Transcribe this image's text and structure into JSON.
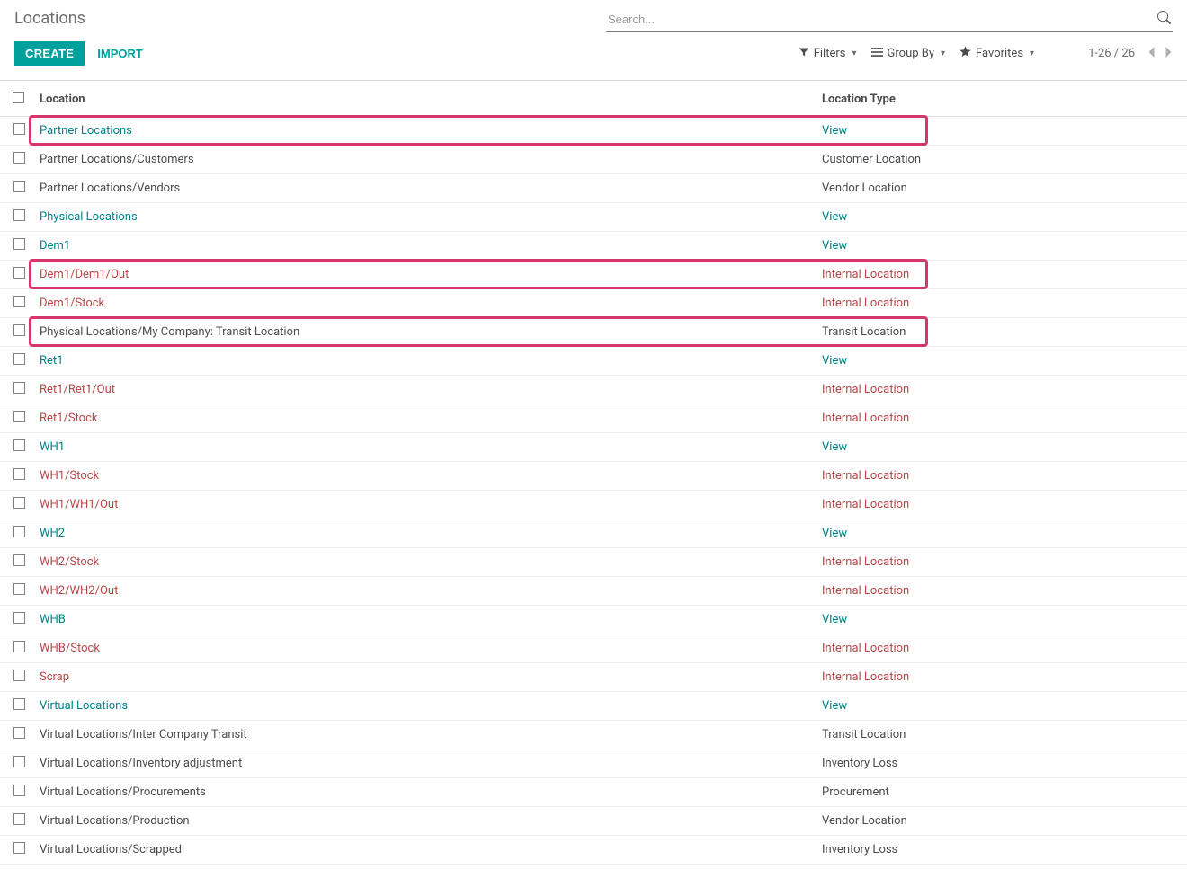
{
  "header": {
    "title": "Locations",
    "search_placeholder": "Search...",
    "create": "CREATE",
    "import": "IMPORT",
    "filters": "Filters",
    "group_by": "Group By",
    "favorites": "Favorites",
    "pager": "1-26 / 26"
  },
  "columns": {
    "location": "Location",
    "type": "Location Type"
  },
  "rows": [
    {
      "loc": "Partner Locations",
      "type": "View",
      "loc_style": "teal",
      "type_style": "teal",
      "hl": true
    },
    {
      "loc": "Partner Locations/Customers",
      "type": "Customer Location",
      "loc_style": "dark",
      "type_style": "dark"
    },
    {
      "loc": "Partner Locations/Vendors",
      "type": "Vendor Location",
      "loc_style": "dark",
      "type_style": "dark"
    },
    {
      "loc": "Physical Locations",
      "type": "View",
      "loc_style": "teal",
      "type_style": "teal"
    },
    {
      "loc": "Dem1",
      "type": "View",
      "loc_style": "teal",
      "type_style": "teal"
    },
    {
      "loc": "Dem1/Dem1/Out",
      "type": "Internal Location",
      "loc_style": "red",
      "type_style": "red",
      "hl": true
    },
    {
      "loc": "Dem1/Stock",
      "type": "Internal Location",
      "loc_style": "red",
      "type_style": "red"
    },
    {
      "loc": "Physical Locations/My Company: Transit Location",
      "type": "Transit Location",
      "loc_style": "dark",
      "type_style": "dark",
      "hl": true
    },
    {
      "loc": "Ret1",
      "type": "View",
      "loc_style": "teal",
      "type_style": "teal"
    },
    {
      "loc": "Ret1/Ret1/Out",
      "type": "Internal Location",
      "loc_style": "red",
      "type_style": "red"
    },
    {
      "loc": "Ret1/Stock",
      "type": "Internal Location",
      "loc_style": "red",
      "type_style": "red"
    },
    {
      "loc": "WH1",
      "type": "View",
      "loc_style": "teal",
      "type_style": "teal"
    },
    {
      "loc": "WH1/Stock",
      "type": "Internal Location",
      "loc_style": "red",
      "type_style": "red"
    },
    {
      "loc": "WH1/WH1/Out",
      "type": "Internal Location",
      "loc_style": "red",
      "type_style": "red"
    },
    {
      "loc": "WH2",
      "type": "View",
      "loc_style": "teal",
      "type_style": "teal"
    },
    {
      "loc": "WH2/Stock",
      "type": "Internal Location",
      "loc_style": "red",
      "type_style": "red"
    },
    {
      "loc": "WH2/WH2/Out",
      "type": "Internal Location",
      "loc_style": "red",
      "type_style": "red"
    },
    {
      "loc": "WHB",
      "type": "View",
      "loc_style": "teal",
      "type_style": "teal"
    },
    {
      "loc": "WHB/Stock",
      "type": "Internal Location",
      "loc_style": "red",
      "type_style": "red"
    },
    {
      "loc": "Scrap",
      "type": "Internal Location",
      "loc_style": "red",
      "type_style": "red"
    },
    {
      "loc": "Virtual Locations",
      "type": "View",
      "loc_style": "teal",
      "type_style": "teal"
    },
    {
      "loc": "Virtual Locations/Inter Company Transit",
      "type": "Transit Location",
      "loc_style": "dark",
      "type_style": "dark"
    },
    {
      "loc": "Virtual Locations/Inventory adjustment",
      "type": "Inventory Loss",
      "loc_style": "dark",
      "type_style": "dark"
    },
    {
      "loc": "Virtual Locations/Procurements",
      "type": "Procurement",
      "loc_style": "dark",
      "type_style": "dark"
    },
    {
      "loc": "Virtual Locations/Production",
      "type": "Vendor Location",
      "loc_style": "dark",
      "type_style": "dark"
    },
    {
      "loc": "Virtual Locations/Scrapped",
      "type": "Inventory Loss",
      "loc_style": "dark",
      "type_style": "dark"
    }
  ]
}
